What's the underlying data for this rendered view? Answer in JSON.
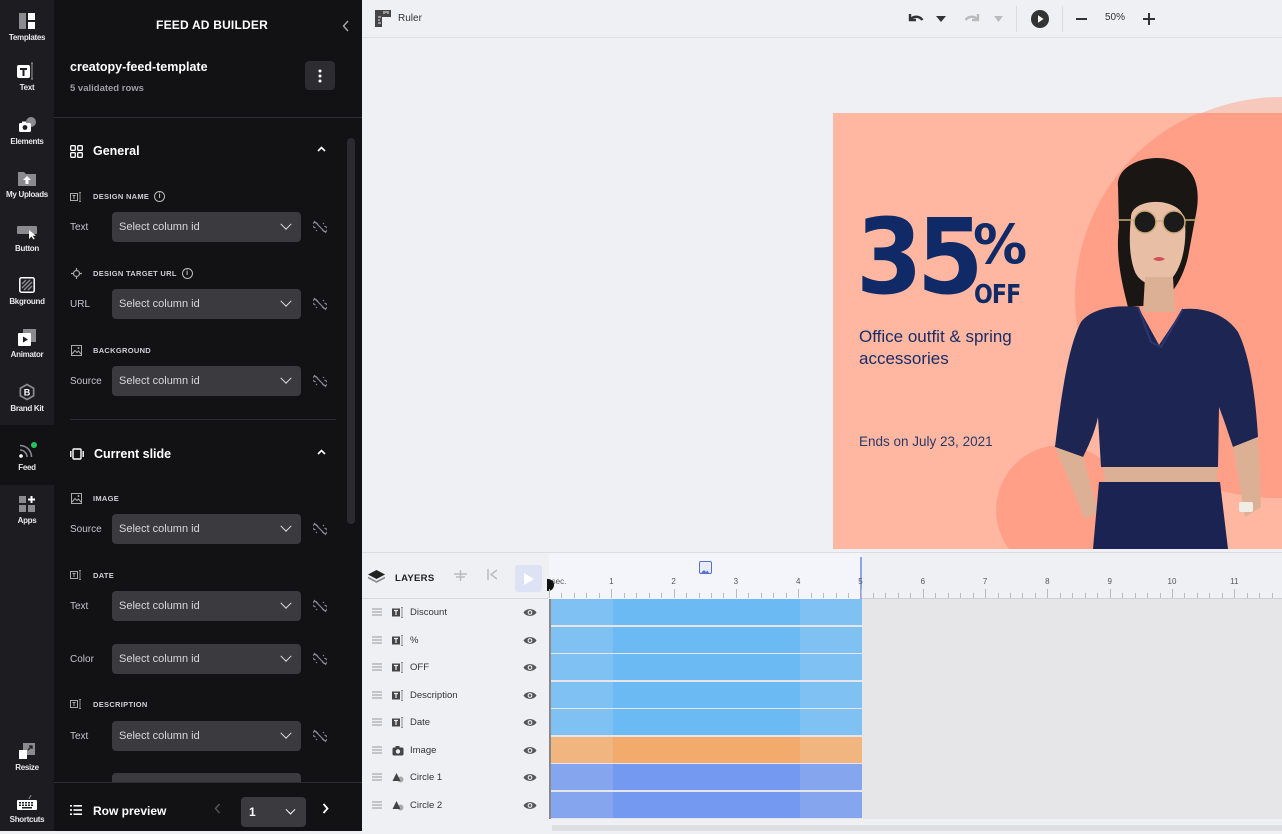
{
  "rail": {
    "items": [
      {
        "id": "templates",
        "label": "Templates",
        "icon": "templates-icon"
      },
      {
        "id": "text",
        "label": "Text",
        "icon": "text-icon"
      },
      {
        "id": "elements",
        "label": "Elements",
        "icon": "elements-icon"
      },
      {
        "id": "uploads",
        "label": "My Uploads",
        "icon": "upload-icon"
      },
      {
        "id": "button",
        "label": "Button",
        "icon": "button-icon"
      },
      {
        "id": "background",
        "label": "Bkground",
        "icon": "background-icon"
      },
      {
        "id": "animator",
        "label": "Animator",
        "icon": "animator-icon"
      },
      {
        "id": "brandkit",
        "label": "Brand Kit",
        "icon": "brand-kit-icon"
      },
      {
        "id": "feed",
        "label": "Feed",
        "icon": "feed-icon",
        "active": true,
        "status_color": "#22c55e"
      },
      {
        "id": "apps",
        "label": "Apps",
        "icon": "apps-icon"
      }
    ],
    "bottom": [
      {
        "id": "resize",
        "label": "Resize",
        "icon": "resize-icon"
      },
      {
        "id": "shortcuts",
        "label": "Shortcuts",
        "icon": "keyboard-icon"
      }
    ]
  },
  "panel": {
    "title": "FEED AD BUILDER",
    "feed_name": "creatopy-feed-template",
    "feed_rows": "5 validated rows",
    "general": {
      "title": "General",
      "fields": [
        {
          "label": "DESIGN NAME",
          "has_info": true,
          "rows": [
            {
              "label": "Text",
              "placeholder": "Select column id"
            }
          ]
        },
        {
          "label": "DESIGN TARGET URL",
          "has_info": true,
          "rows": [
            {
              "label": "URL",
              "placeholder": "Select column id"
            }
          ]
        },
        {
          "label": "BACKGROUND",
          "has_info": false,
          "rows": [
            {
              "label": "Source",
              "placeholder": "Select column id"
            }
          ]
        }
      ]
    },
    "current_slide": {
      "title": "Current slide",
      "fields": [
        {
          "label": "IMAGE",
          "rows": [
            {
              "label": "Source",
              "placeholder": "Select column id"
            }
          ]
        },
        {
          "label": "DATE",
          "rows": [
            {
              "label": "Text",
              "placeholder": "Select column id"
            },
            {
              "label": "Color",
              "placeholder": "Select column id"
            }
          ]
        },
        {
          "label": "DESCRIPTION",
          "rows": [
            {
              "label": "Text",
              "placeholder": "Select column id"
            }
          ]
        }
      ]
    },
    "row_preview": {
      "label": "Row preview",
      "value": "1"
    }
  },
  "toolbar": {
    "ruler_label": "Ruler",
    "zoom": "50%"
  },
  "ad": {
    "discount": "35",
    "percent": "%",
    "off": "OFF",
    "description": "Office outfit & spring accessories",
    "date": "Ends on July 23, 2021",
    "colors": {
      "background": "#ffb7a2",
      "circle": "#ff9f87",
      "text": "#0f2a66"
    }
  },
  "timeline": {
    "title": "LAYERS",
    "unit_label": "sec.",
    "ruler_marks": [
      "1",
      "2",
      "3",
      "4",
      "5",
      "6",
      "7",
      "8",
      "9",
      "10",
      "11"
    ],
    "duration_sec": 5,
    "layers": [
      {
        "name": "Discount",
        "type": "text",
        "color": "#6bbaf3",
        "start": 0,
        "end": 5
      },
      {
        "name": "%",
        "type": "text",
        "color": "#6bbaf3",
        "start": 0,
        "end": 5
      },
      {
        "name": "OFF",
        "type": "text",
        "color": "#6bbaf3",
        "start": 0,
        "end": 5
      },
      {
        "name": "Description",
        "type": "text",
        "color": "#6bbaf3",
        "start": 0,
        "end": 5
      },
      {
        "name": "Date",
        "type": "text",
        "color": "#6bbaf3",
        "start": 0,
        "end": 5
      },
      {
        "name": "Image",
        "type": "image",
        "color": "#f2ab6c",
        "start": 0,
        "end": 5
      },
      {
        "name": "Circle 1",
        "type": "shape",
        "color": "#7399f0",
        "start": 0,
        "end": 5
      },
      {
        "name": "Circle 2",
        "type": "shape",
        "color": "#7399f0",
        "start": 0,
        "end": 5
      }
    ],
    "anim_in_end": 1,
    "anim_out_start": 4
  }
}
